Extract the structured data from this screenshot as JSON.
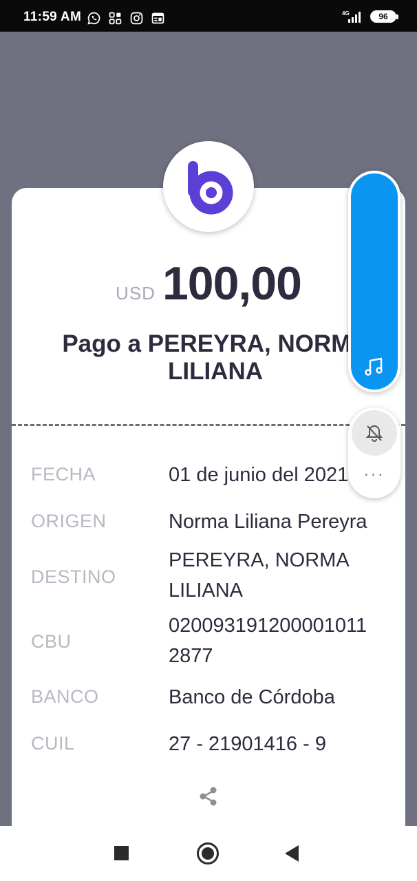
{
  "status_bar": {
    "time": "11:59 AM",
    "network": "4G",
    "battery": "96"
  },
  "receipt": {
    "currency": "USD",
    "amount": "100,00",
    "title_line1": "Pago a PEREYRA, NORMA",
    "title_line2": "LILIANA",
    "details": [
      {
        "label": "FECHA",
        "value": "01 de junio del 2021"
      },
      {
        "label": "ORIGEN",
        "value": "Norma Liliana Pereyra"
      },
      {
        "label": "DESTINO",
        "value_line1": "PEREYRA, NORMA",
        "value_line2": "LILIANA"
      },
      {
        "label": "CBU",
        "value_line1": "020093191200001011",
        "value_line2": "2877"
      },
      {
        "label": "BANCO",
        "value": "Banco de Córdoba"
      },
      {
        "label": "CUIL",
        "value": "27 - 21901416 - 9"
      }
    ]
  },
  "floating_widget": {
    "more": "···"
  },
  "icons": [
    "whatsapp-icon",
    "apps-grid-icon",
    "instagram-icon",
    "news-icon",
    "signal-icon",
    "bank-logo-icon",
    "music-note-icon",
    "bell-off-icon",
    "share-icon"
  ],
  "colors": {
    "brand_purple": "#5b3fd6",
    "widget_blue": "#0a95f3",
    "background": "#6f7080",
    "text_dark": "#2c2c3e",
    "label_gray": "#b7b8c2"
  }
}
